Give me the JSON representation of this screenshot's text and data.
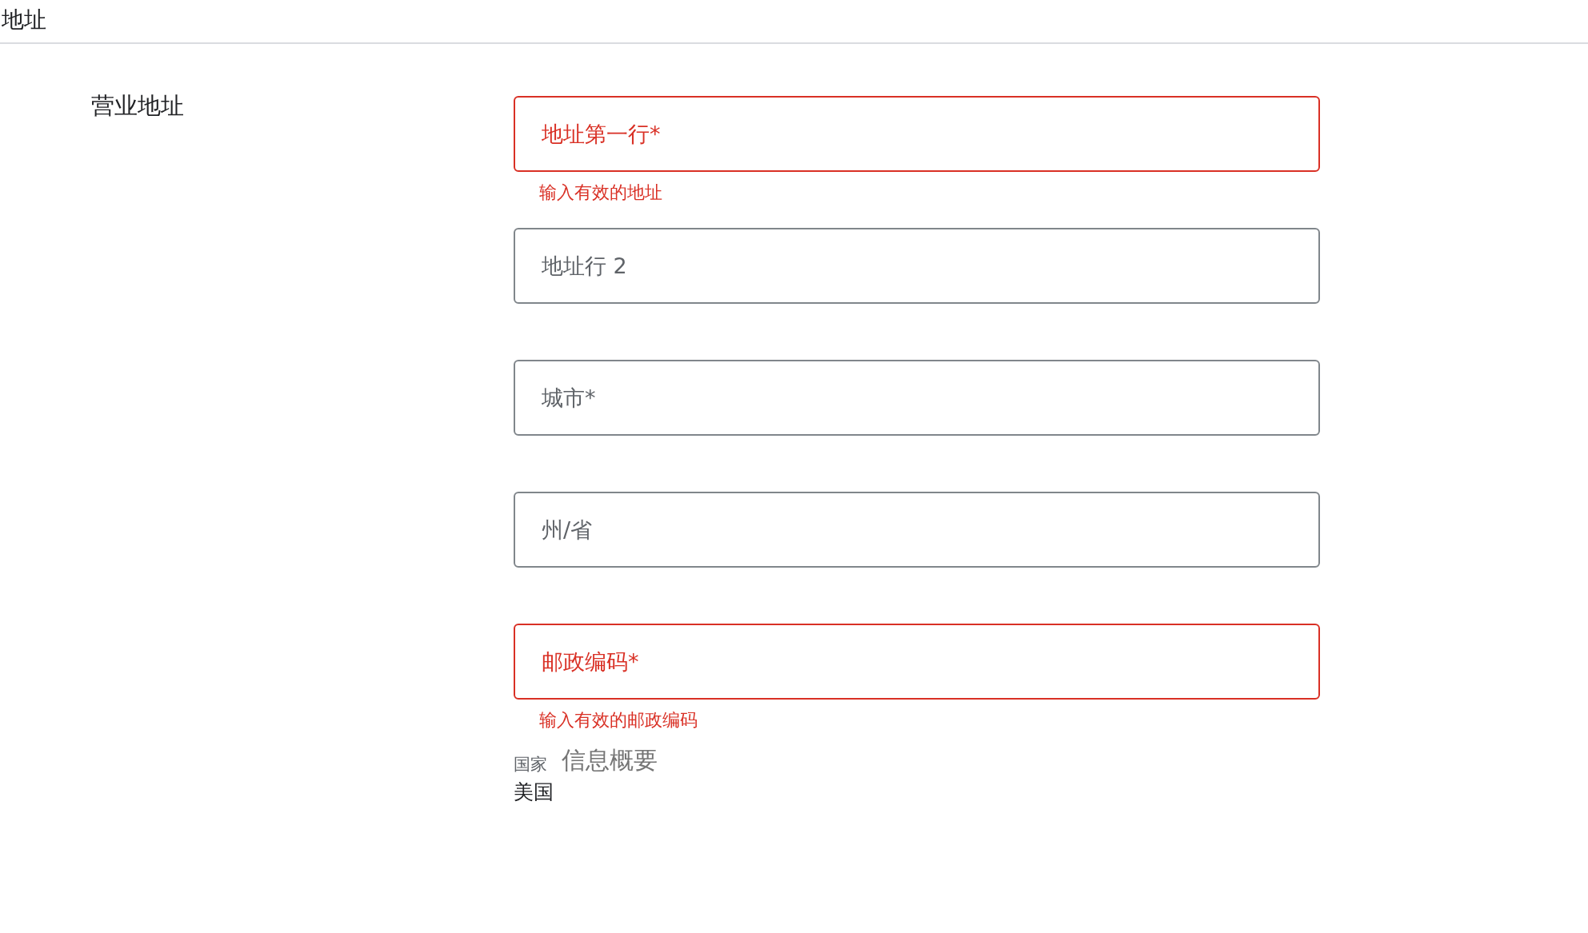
{
  "header": {
    "title": "地址"
  },
  "section": {
    "title": "营业地址"
  },
  "fields": [
    {
      "placeholder": "地址第一行*",
      "invalid": true,
      "error": "输入有效的地址"
    },
    {
      "placeholder": "地址行 2",
      "invalid": false
    },
    {
      "placeholder": "城市*",
      "invalid": false
    },
    {
      "placeholder": "州/省",
      "invalid": false
    },
    {
      "placeholder": "邮政编码*",
      "invalid": true,
      "error": "输入有效的邮政编码"
    }
  ],
  "country": {
    "label": "国家",
    "value": "美国"
  },
  "summary_heading": "信息概要"
}
